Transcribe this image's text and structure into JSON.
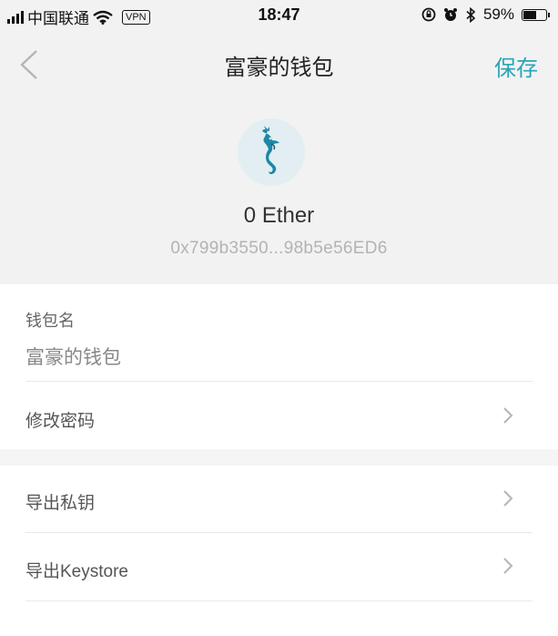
{
  "status_bar": {
    "carrier": "中国联通",
    "vpn": "VPN",
    "time": "18:47",
    "battery": "59%",
    "battery_level": 0.59,
    "icons": [
      "signal-icon",
      "wifi-icon",
      "rotation-lock-icon",
      "alarm-icon",
      "bluetooth-icon",
      "battery-icon"
    ]
  },
  "nav": {
    "back_icon": "chevron-left-icon",
    "title": "富豪的钱包",
    "save_label": "保存"
  },
  "wallet": {
    "avatar_icon": "seahorse-icon",
    "balance": "0 Ether",
    "address": "0x799b3550...98b5e56ED6"
  },
  "settings": {
    "name_label": "钱包名",
    "name_value": "富豪的钱包",
    "items": [
      {
        "label": "修改密码",
        "icon": "chevron-right-icon"
      },
      {
        "label": "导出私钥",
        "icon": "chevron-right-icon"
      },
      {
        "label": "导出Keystore",
        "icon": "chevron-right-icon"
      }
    ]
  },
  "colors": {
    "accent": "#2aa4b8",
    "header_bg": "#f2f2f2"
  }
}
